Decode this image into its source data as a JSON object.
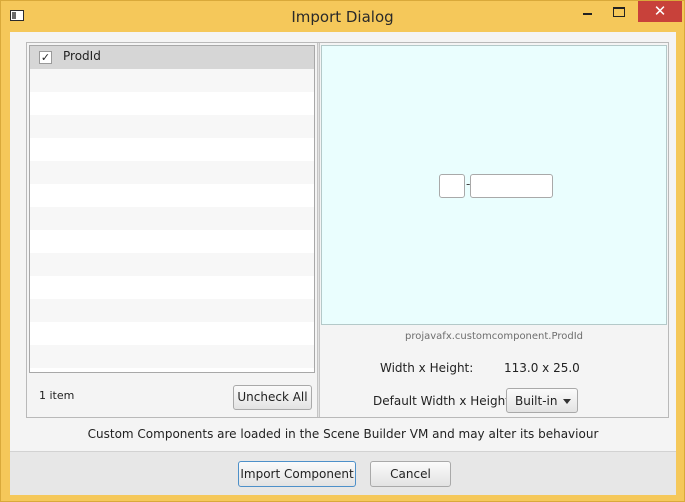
{
  "window": {
    "title": "Import Dialog",
    "close_glyph": "✕",
    "icons": [
      "app-icon",
      "minimize-icon",
      "maximize-icon",
      "close-icon"
    ]
  },
  "components_list": {
    "items": [
      {
        "label": "ProdId",
        "checked": true,
        "check_glyph": "✓"
      }
    ],
    "count": "1 item",
    "uncheck_all_label": "Uncheck All"
  },
  "preview": {
    "class_name": "projavafx.customcomponent.ProdId",
    "separator": "-",
    "width_height_label": "Width x Height:",
    "width_height_value": "113.0 x 25.0",
    "default_wh_label": "Default Width x Height:",
    "default_wh_selected": "Built-in",
    "background_color": "#eafefe"
  },
  "notice": "Custom Components are loaded in the Scene Builder VM and may alter its behaviour",
  "actions": {
    "import_label": "Import Component",
    "cancel_label": "Cancel"
  },
  "colors": {
    "window_frame": "#f5c85a",
    "close_button": "#c8413a",
    "default_button_border": "#4d90c9"
  }
}
